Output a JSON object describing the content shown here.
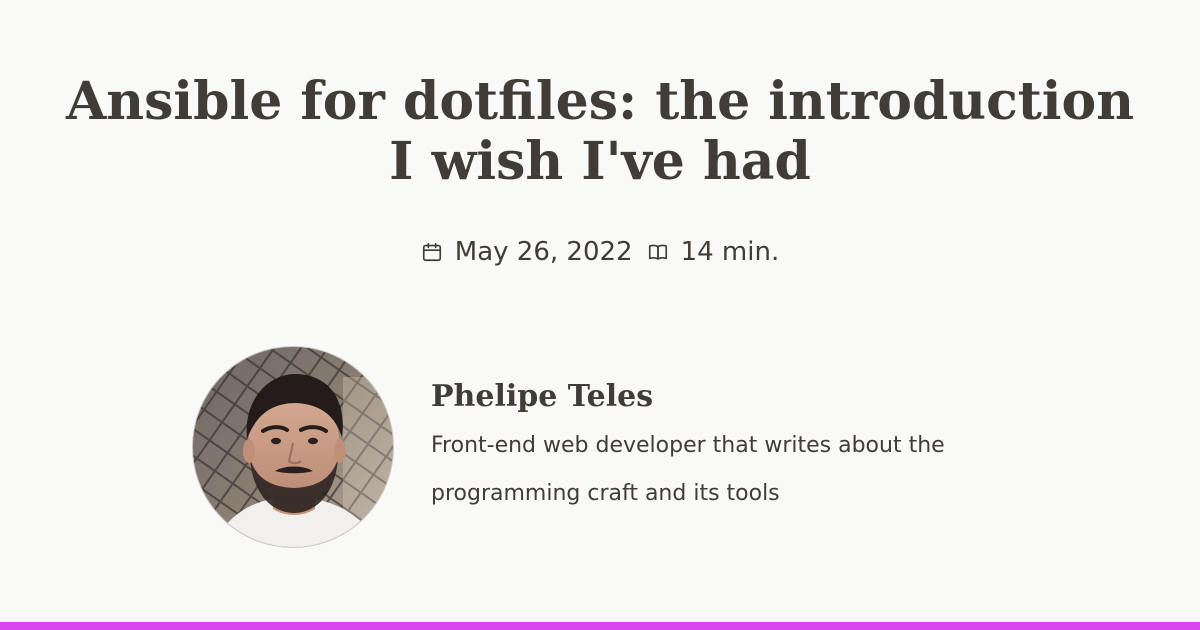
{
  "post": {
    "title": "Ansible for dotfiles: the introduction I wish I've had",
    "date": "May 26, 2022",
    "reading_time": "14 min."
  },
  "author": {
    "name": "Phelipe Teles",
    "bio": "Front-end web developer that writes about the programming craft and its tools"
  },
  "icons": {
    "date": "calendar-icon",
    "reading_time": "book-open-icon"
  },
  "colors": {
    "background": "#f9f9f8",
    "text": "#403d39",
    "accent_bar": "#d946ef"
  }
}
